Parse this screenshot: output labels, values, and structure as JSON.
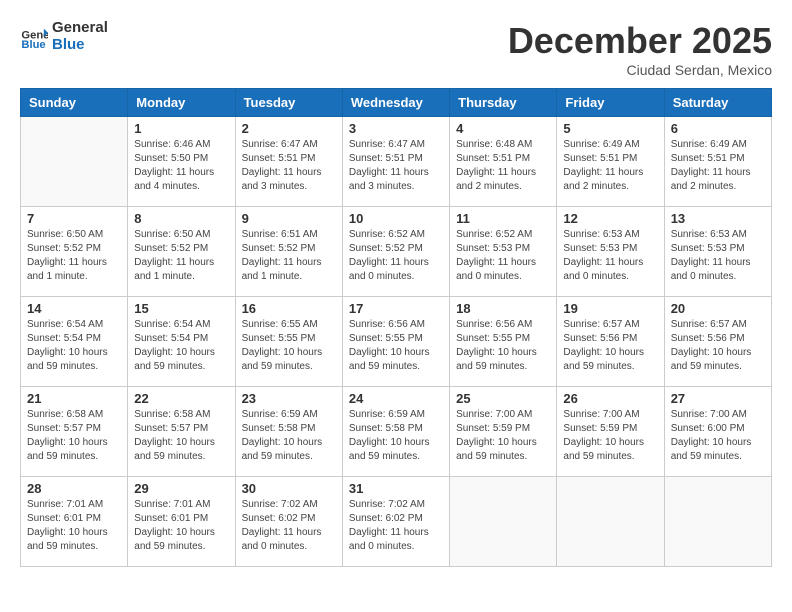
{
  "header": {
    "logo_line1": "General",
    "logo_line2": "Blue",
    "month": "December 2025",
    "location": "Ciudad Serdan, Mexico"
  },
  "weekdays": [
    "Sunday",
    "Monday",
    "Tuesday",
    "Wednesday",
    "Thursday",
    "Friday",
    "Saturday"
  ],
  "weeks": [
    [
      {
        "day": "",
        "info": ""
      },
      {
        "day": "1",
        "info": "Sunrise: 6:46 AM\nSunset: 5:50 PM\nDaylight: 11 hours\nand 4 minutes."
      },
      {
        "day": "2",
        "info": "Sunrise: 6:47 AM\nSunset: 5:51 PM\nDaylight: 11 hours\nand 3 minutes."
      },
      {
        "day": "3",
        "info": "Sunrise: 6:47 AM\nSunset: 5:51 PM\nDaylight: 11 hours\nand 3 minutes."
      },
      {
        "day": "4",
        "info": "Sunrise: 6:48 AM\nSunset: 5:51 PM\nDaylight: 11 hours\nand 2 minutes."
      },
      {
        "day": "5",
        "info": "Sunrise: 6:49 AM\nSunset: 5:51 PM\nDaylight: 11 hours\nand 2 minutes."
      },
      {
        "day": "6",
        "info": "Sunrise: 6:49 AM\nSunset: 5:51 PM\nDaylight: 11 hours\nand 2 minutes."
      }
    ],
    [
      {
        "day": "7",
        "info": "Sunrise: 6:50 AM\nSunset: 5:52 PM\nDaylight: 11 hours\nand 1 minute."
      },
      {
        "day": "8",
        "info": "Sunrise: 6:50 AM\nSunset: 5:52 PM\nDaylight: 11 hours\nand 1 minute."
      },
      {
        "day": "9",
        "info": "Sunrise: 6:51 AM\nSunset: 5:52 PM\nDaylight: 11 hours\nand 1 minute."
      },
      {
        "day": "10",
        "info": "Sunrise: 6:52 AM\nSunset: 5:52 PM\nDaylight: 11 hours\nand 0 minutes."
      },
      {
        "day": "11",
        "info": "Sunrise: 6:52 AM\nSunset: 5:53 PM\nDaylight: 11 hours\nand 0 minutes."
      },
      {
        "day": "12",
        "info": "Sunrise: 6:53 AM\nSunset: 5:53 PM\nDaylight: 11 hours\nand 0 minutes."
      },
      {
        "day": "13",
        "info": "Sunrise: 6:53 AM\nSunset: 5:53 PM\nDaylight: 11 hours\nand 0 minutes."
      }
    ],
    [
      {
        "day": "14",
        "info": "Sunrise: 6:54 AM\nSunset: 5:54 PM\nDaylight: 10 hours\nand 59 minutes."
      },
      {
        "day": "15",
        "info": "Sunrise: 6:54 AM\nSunset: 5:54 PM\nDaylight: 10 hours\nand 59 minutes."
      },
      {
        "day": "16",
        "info": "Sunrise: 6:55 AM\nSunset: 5:55 PM\nDaylight: 10 hours\nand 59 minutes."
      },
      {
        "day": "17",
        "info": "Sunrise: 6:56 AM\nSunset: 5:55 PM\nDaylight: 10 hours\nand 59 minutes."
      },
      {
        "day": "18",
        "info": "Sunrise: 6:56 AM\nSunset: 5:55 PM\nDaylight: 10 hours\nand 59 minutes."
      },
      {
        "day": "19",
        "info": "Sunrise: 6:57 AM\nSunset: 5:56 PM\nDaylight: 10 hours\nand 59 minutes."
      },
      {
        "day": "20",
        "info": "Sunrise: 6:57 AM\nSunset: 5:56 PM\nDaylight: 10 hours\nand 59 minutes."
      }
    ],
    [
      {
        "day": "21",
        "info": "Sunrise: 6:58 AM\nSunset: 5:57 PM\nDaylight: 10 hours\nand 59 minutes."
      },
      {
        "day": "22",
        "info": "Sunrise: 6:58 AM\nSunset: 5:57 PM\nDaylight: 10 hours\nand 59 minutes."
      },
      {
        "day": "23",
        "info": "Sunrise: 6:59 AM\nSunset: 5:58 PM\nDaylight: 10 hours\nand 59 minutes."
      },
      {
        "day": "24",
        "info": "Sunrise: 6:59 AM\nSunset: 5:58 PM\nDaylight: 10 hours\nand 59 minutes."
      },
      {
        "day": "25",
        "info": "Sunrise: 7:00 AM\nSunset: 5:59 PM\nDaylight: 10 hours\nand 59 minutes."
      },
      {
        "day": "26",
        "info": "Sunrise: 7:00 AM\nSunset: 5:59 PM\nDaylight: 10 hours\nand 59 minutes."
      },
      {
        "day": "27",
        "info": "Sunrise: 7:00 AM\nSunset: 6:00 PM\nDaylight: 10 hours\nand 59 minutes."
      }
    ],
    [
      {
        "day": "28",
        "info": "Sunrise: 7:01 AM\nSunset: 6:01 PM\nDaylight: 10 hours\nand 59 minutes."
      },
      {
        "day": "29",
        "info": "Sunrise: 7:01 AM\nSunset: 6:01 PM\nDaylight: 10 hours\nand 59 minutes."
      },
      {
        "day": "30",
        "info": "Sunrise: 7:02 AM\nSunset: 6:02 PM\nDaylight: 11 hours\nand 0 minutes."
      },
      {
        "day": "31",
        "info": "Sunrise: 7:02 AM\nSunset: 6:02 PM\nDaylight: 11 hours\nand 0 minutes."
      },
      {
        "day": "",
        "info": ""
      },
      {
        "day": "",
        "info": ""
      },
      {
        "day": "",
        "info": ""
      }
    ]
  ]
}
